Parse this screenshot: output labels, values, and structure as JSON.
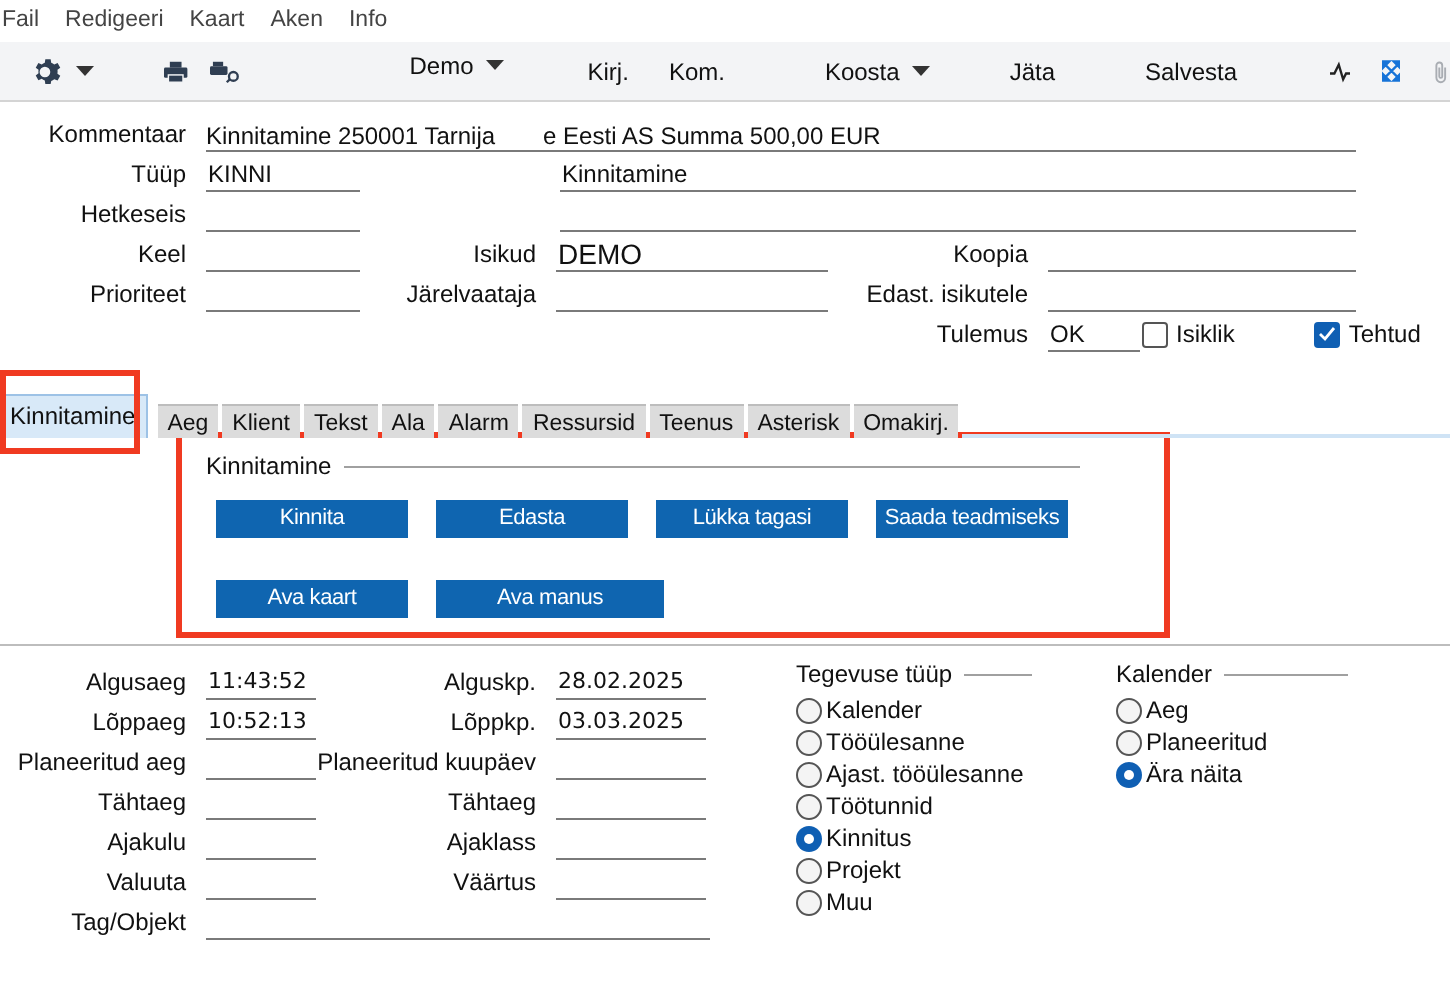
{
  "menu": [
    "Fail",
    "Redigeeri",
    "Kaart",
    "Aken",
    "Info"
  ],
  "toolbar": {
    "profile": "Demo",
    "buttons": [
      {
        "label": "Kirj.",
        "kind": "button"
      },
      {
        "label": "Kom.",
        "kind": "button"
      },
      {
        "label": "Koosta",
        "kind": "dropdown"
      },
      {
        "label": "Jäta",
        "kind": "button"
      },
      {
        "label": "Salvesta",
        "kind": "button"
      }
    ]
  },
  "header": {
    "comment": {
      "label": "Kommentaar",
      "value_start": "Kinnitamine 250001 Tarnija",
      "value_end": "e Eesti AS Summa 500,00 EUR"
    },
    "type": {
      "label": "Tüüp",
      "code": "KINNI",
      "name": "Kinnitamine"
    },
    "state": {
      "label": "Hetkeseis"
    },
    "grid": [
      [
        {
          "label": "Keel"
        },
        {
          "label": "Isikud",
          "value": "DEMO"
        },
        {
          "label": "Koopia"
        }
      ],
      [
        {
          "label": "Prioriteet"
        },
        {
          "label": "Järelvaataja"
        },
        {
          "label": "Edast. isikutele"
        }
      ]
    ],
    "result": {
      "label": "Tulemus",
      "value": "OK"
    },
    "checkboxes": [
      {
        "label": "Isiklik",
        "checked": false
      },
      {
        "label": "Tehtud",
        "checked": true
      }
    ]
  },
  "tabs": [
    {
      "label": "Kinnitamine",
      "selected": true
    },
    {
      "label": "Aeg",
      "selected": false
    },
    {
      "label": "Klient",
      "selected": false
    },
    {
      "label": "Tekst",
      "selected": false
    },
    {
      "label": "Ala",
      "selected": false
    },
    {
      "label": "Alarm",
      "selected": false
    },
    {
      "label": "Ressursid",
      "selected": false
    },
    {
      "label": "Teenus",
      "selected": false
    },
    {
      "label": "Asterisk",
      "selected": false
    },
    {
      "label": "Omakirj.",
      "selected": false
    }
  ],
  "panel": {
    "title": "Kinnitamine",
    "button_rows": [
      [
        "Kinnita",
        "Edasta",
        "Lükka tagasi",
        "Saada teadmiseks"
      ],
      [
        "Ava kaart",
        "Ava manus"
      ]
    ]
  },
  "times": {
    "rows": [
      [
        {
          "label": "Algusaeg",
          "value": "11:43:52"
        },
        {
          "label": "Alguskp.",
          "value": "28.02.2025"
        }
      ],
      [
        {
          "label": "Lõppaeg",
          "value": "10:52:13"
        },
        {
          "label": "Lõppkp.",
          "value": "03.03.2025"
        }
      ],
      [
        {
          "label": "Planeeritud aeg"
        },
        {
          "label": "Planeeritud kuupäev"
        }
      ],
      [
        {
          "label": "Tähtaeg"
        },
        {
          "label": "Tähtaeg"
        }
      ],
      [
        {
          "label": "Ajakulu"
        },
        {
          "label": "Ajaklass"
        }
      ],
      [
        {
          "label": "Valuuta"
        },
        {
          "label": "Väärtus"
        }
      ]
    ],
    "tag": {
      "label": "Tag/Objekt"
    }
  },
  "radio_groups": [
    {
      "title": "Tegevuse tüüp",
      "options": [
        {
          "label": "Kalender",
          "selected": false
        },
        {
          "label": "Tööülesanne",
          "selected": false
        },
        {
          "label": "Ajast. tööülesanne",
          "selected": false
        },
        {
          "label": "Töötunnid",
          "selected": false
        },
        {
          "label": "Kinnitus",
          "selected": true
        },
        {
          "label": "Projekt",
          "selected": false
        },
        {
          "label": "Muu",
          "selected": false
        }
      ]
    },
    {
      "title": "Kalender",
      "options": [
        {
          "label": "Aeg",
          "selected": false
        },
        {
          "label": "Planeeritud",
          "selected": false
        },
        {
          "label": "Ära näita",
          "selected": true
        }
      ]
    }
  ]
}
